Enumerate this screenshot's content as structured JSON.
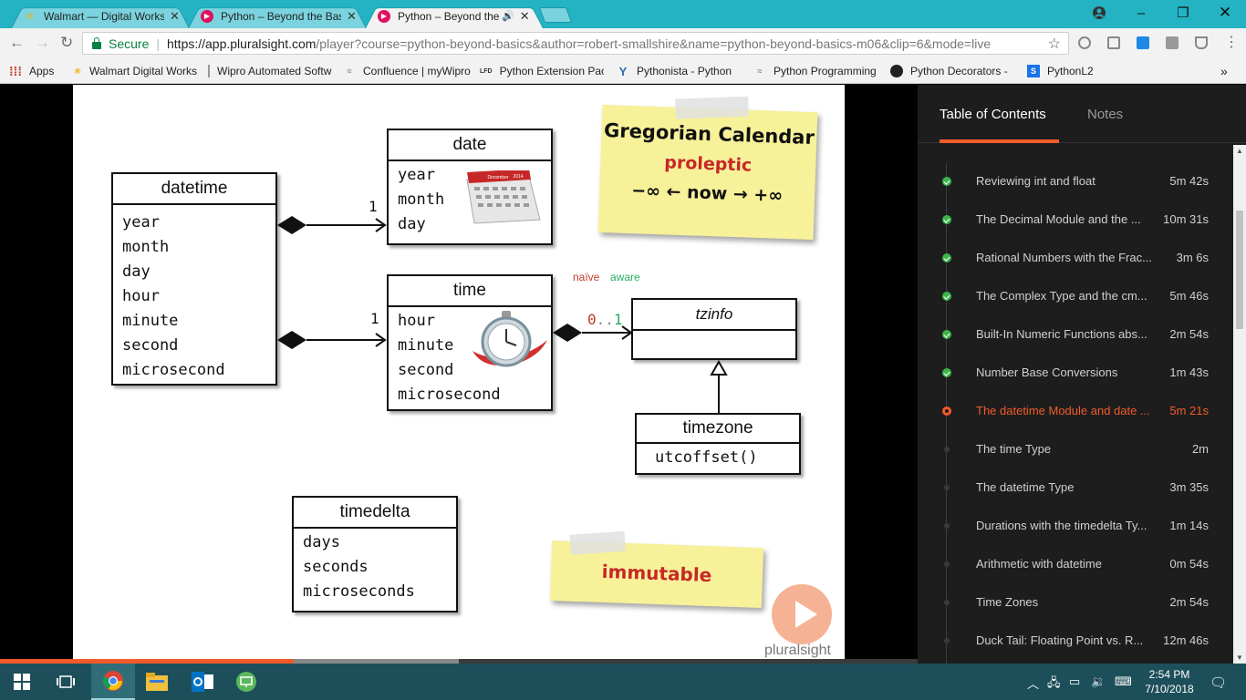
{
  "browser": {
    "tabs": [
      {
        "title": "Walmart — Digital Works",
        "icon": "walmart-spark-icon",
        "active": false
      },
      {
        "title": "Python – Beyond the Basics",
        "icon": "pluralsight-icon",
        "active": false
      },
      {
        "title": "Python – Beyond the Basics",
        "icon": "pluralsight-icon",
        "active": true
      }
    ],
    "address": {
      "secure_label": "Secure",
      "url_host": "https://app.pluralsight.com",
      "url_rest": "/player?course=python-beyond-basics&author=robert-smallshire&name=python-beyond-basics-m06&clip=6&mode=live"
    },
    "bookmarks": [
      {
        "label": "Apps",
        "icon": "apps-grid-icon"
      },
      {
        "label": "Walmart Digital Works",
        "icon": "walmart-spark-icon"
      },
      {
        "label": "Wipro Automated Software",
        "icon": "page-icon"
      },
      {
        "label": "Confluence | myWipro",
        "icon": "confluence-icon"
      },
      {
        "label": "Python Extension Packages",
        "icon": "lfd-icon"
      },
      {
        "label": "Pythonista - Python",
        "icon": "ycombinator-icon"
      },
      {
        "label": "Python Programming",
        "icon": "python-icon"
      },
      {
        "label": "Python Decorators -",
        "icon": "github-icon"
      },
      {
        "label": "PythonL2",
        "icon": "sharepoint-icon"
      }
    ],
    "bookmarks_overflow": "»"
  },
  "slide": {
    "datetime": {
      "title": "datetime",
      "fields": [
        "year",
        "month",
        "day",
        "hour",
        "minute",
        "second",
        "microsecond"
      ]
    },
    "date": {
      "title": "date",
      "fields": [
        "year",
        "month",
        "day"
      ],
      "calendar_month": "December",
      "calendar_year": "2014"
    },
    "time": {
      "title": "time",
      "fields": [
        "hour",
        "minute",
        "second",
        "microsecond"
      ]
    },
    "tzinfo": {
      "title": "tzinfo"
    },
    "timezone": {
      "title": "timezone",
      "fields": [
        "utcoffset()"
      ]
    },
    "timedelta": {
      "title": "timedelta",
      "fields": [
        "days",
        "seconds",
        "microseconds"
      ]
    },
    "mult_date": "1",
    "mult_time": "1",
    "mult_tz_zero": "0",
    "mult_tz_dots": "..",
    "mult_tz_one": "1",
    "naive_label": "naïve",
    "aware_label": "aware",
    "naive_color": "#c0392b",
    "aware_color": "#27ae60",
    "note_calendar": {
      "line1": "Gregorian Calendar",
      "line2": "proleptic",
      "line3": "−∞ ← now → +∞"
    },
    "note_immutable": "immutable",
    "watermark": "pluralsight"
  },
  "player": {
    "progress_played": 0.32,
    "progress_buffered": 0.5
  },
  "sidebar": {
    "tab_toc": "Table of Contents",
    "tab_notes": "Notes",
    "items": [
      {
        "title": "Reviewing int and float",
        "duration": "5m 42s",
        "status": "done"
      },
      {
        "title": "The Decimal Module and the ...",
        "duration": "10m 31s",
        "status": "done"
      },
      {
        "title": "Rational Numbers with the Frac...",
        "duration": "3m 6s",
        "status": "done"
      },
      {
        "title": "The Complex Type and the cm...",
        "duration": "5m 46s",
        "status": "done"
      },
      {
        "title": "Built-In Numeric Functions abs...",
        "duration": "2m 54s",
        "status": "done"
      },
      {
        "title": "Number Base Conversions",
        "duration": "1m 43s",
        "status": "done"
      },
      {
        "title": "The datetime Module and date ...",
        "duration": "5m 21s",
        "status": "current"
      },
      {
        "title": "The time Type",
        "duration": "2m",
        "status": "todo"
      },
      {
        "title": "The datetime Type",
        "duration": "3m 35s",
        "status": "todo"
      },
      {
        "title": "Durations with the timedelta Ty...",
        "duration": "1m 14s",
        "status": "todo"
      },
      {
        "title": "Arithmetic with datetime",
        "duration": "0m 54s",
        "status": "todo"
      },
      {
        "title": "Time Zones",
        "duration": "2m 54s",
        "status": "todo"
      },
      {
        "title": "Duck Tail: Floating Point vs. R...",
        "duration": "12m 46s",
        "status": "todo"
      }
    ],
    "accent": "#f15b2a"
  },
  "taskbar": {
    "time": "2:54 PM",
    "date": "7/10/2018",
    "apps": [
      "start-icon",
      "task-view-icon",
      "chrome-icon",
      "file-explorer-icon",
      "outlook-icon",
      "remote-desktop-icon"
    ]
  }
}
